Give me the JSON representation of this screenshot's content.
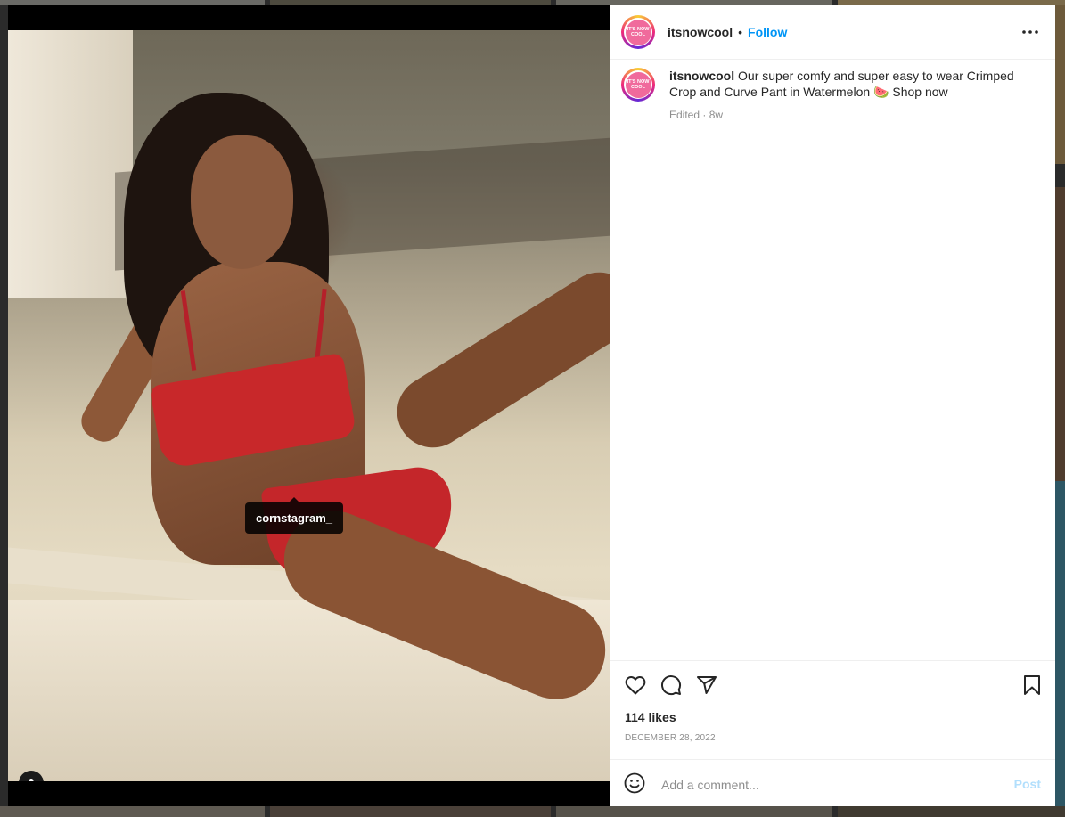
{
  "post": {
    "username": "itsnowcool",
    "header_separator": "•",
    "follow_label": "Follow",
    "avatar_text": "IT'S NOW COOL",
    "caption_text": "Our super comfy and super easy to wear Crimped Crop and Curve Pant in Watermelon 🍉 Shop now",
    "caption_meta": "Edited · 8w",
    "likes": "114 likes",
    "date": "DECEMBER 28, 2022"
  },
  "media": {
    "tag_label": "cornstagram_"
  },
  "comment": {
    "placeholder": "Add a comment...",
    "post_label": "Post"
  },
  "icons": {
    "more": "more-options-icon",
    "like": "heart-icon",
    "comment": "comment-icon",
    "share": "share-icon",
    "save": "bookmark-icon",
    "emoji": "emoji-icon",
    "tag": "user-tag-icon"
  },
  "colors": {
    "follow_blue": "#0095f6",
    "post_disabled": "#b2dffc",
    "text": "#262626",
    "muted": "#8e8e8e"
  }
}
